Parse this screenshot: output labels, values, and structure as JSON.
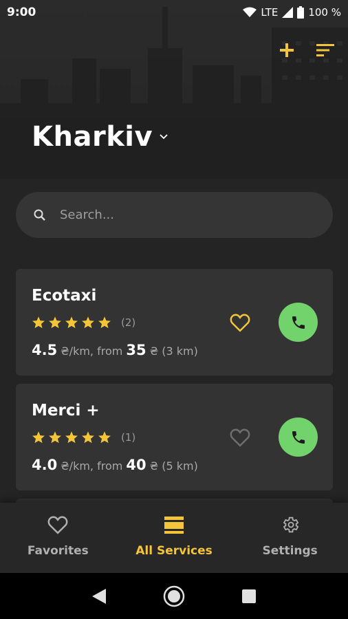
{
  "status": {
    "time": "9:00",
    "network": "LTE",
    "battery": "100 %"
  },
  "header": {
    "city": "Kharkiv",
    "add_icon": "plus-icon",
    "sort_icon": "sort-icon"
  },
  "search": {
    "placeholder": "Search..."
  },
  "colors": {
    "accent": "#f4c43a",
    "call_green": "#72d36d",
    "card_bg": "#333333",
    "background": "#242424"
  },
  "services": [
    {
      "name": "Ecotaxi",
      "rating": 5,
      "reviews": "(2)",
      "price_per_km": "4.5",
      "price_per_km_unit": "₴/km, from",
      "min_price": "35",
      "min_price_unit": "₴ (3 km)",
      "favorite": true
    },
    {
      "name": "Merci +",
      "rating": 5,
      "reviews": "(1)",
      "price_per_km": "4.0",
      "price_per_km_unit": "₴/km, from",
      "min_price": "40",
      "min_price_unit": "₴ (5 km)",
      "favorite": false
    }
  ],
  "nav": {
    "favorites": "Favorites",
    "all_services": "All Services",
    "settings": "Settings",
    "active": "all_services"
  }
}
